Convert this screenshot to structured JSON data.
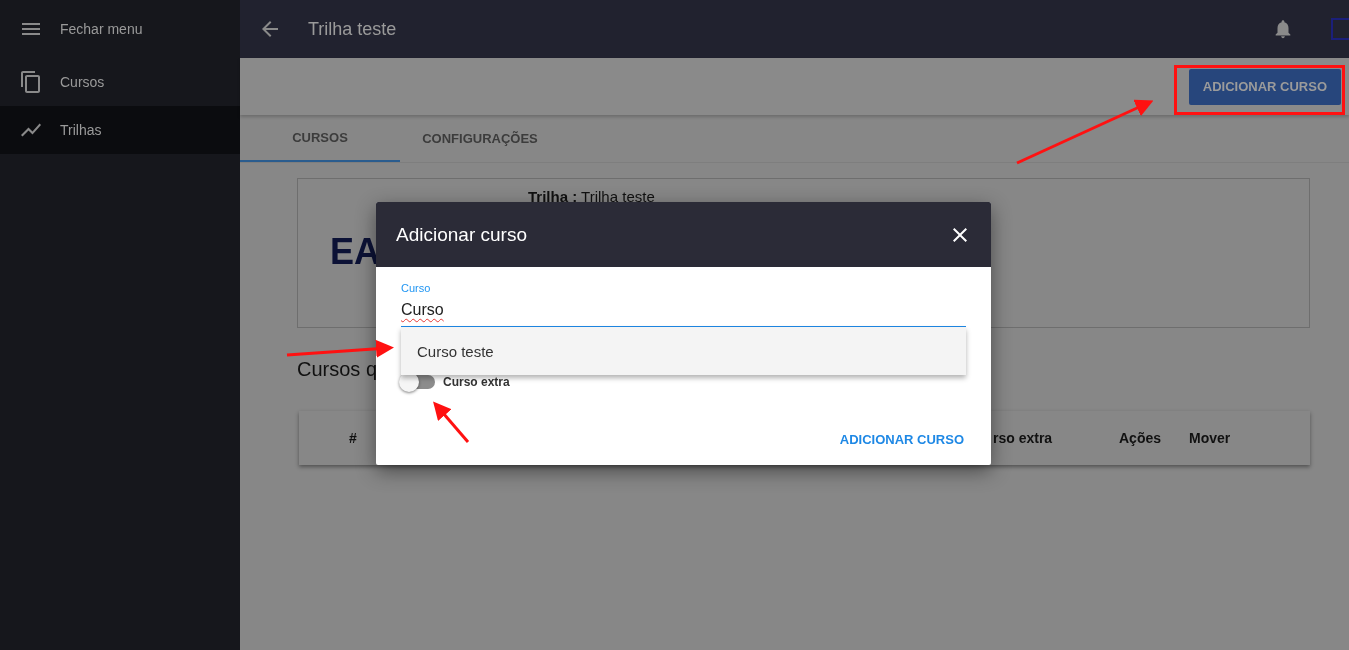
{
  "sidebar": {
    "toggle_label": "Fechar menu",
    "items": [
      {
        "label": "Cursos",
        "selected": false
      },
      {
        "label": "Trilhas",
        "selected": true
      }
    ]
  },
  "topbar": {
    "title": "Trilha teste"
  },
  "toolbar": {
    "button": "ADICIONAR CURSO"
  },
  "tabs": [
    {
      "label": "CURSOS",
      "selected": true
    },
    {
      "label": "CONFIGURAÇÕES",
      "selected": false
    }
  ],
  "card": {
    "logo": "EA",
    "trail_label": "Trilha :",
    "trail_name": "Trilha teste"
  },
  "section_title": "Cursos q",
  "table": {
    "columns": [
      "#",
      "rso extra",
      "Ações",
      "Mover"
    ]
  },
  "dialog": {
    "title": "Adicionar curso",
    "field": {
      "label": "Curso",
      "value": "Curso"
    },
    "suggestions": [
      "Curso teste"
    ],
    "toggle": {
      "label": "Curso extra",
      "on": false
    },
    "submit": "ADICIONAR CURSO"
  }
}
